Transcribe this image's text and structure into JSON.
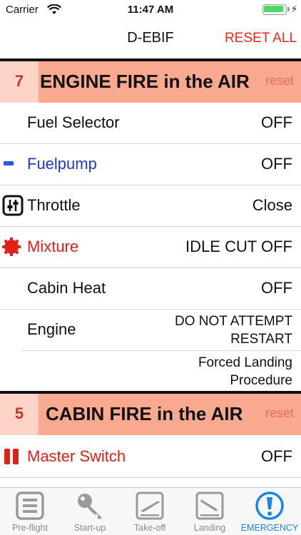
{
  "status": {
    "carrier": "Carrier",
    "time": "11:47 AM"
  },
  "nav": {
    "title": "D-EBIF",
    "reset_all": "RESET ALL"
  },
  "sections": [
    {
      "number": "7",
      "title": "ENGINE FIRE in the AIR",
      "reset": "reset",
      "items": [
        {
          "label": "Fuel Selector",
          "value": "OFF"
        },
        {
          "label": "Fuelpump",
          "value": "OFF",
          "icon": "blue-dash-icon"
        },
        {
          "label": "Throttle",
          "value": "Close",
          "icon": "throttle-icon"
        },
        {
          "label": "Mixture",
          "value": "IDLE CUT OFF",
          "icon": "red-gear-icon"
        },
        {
          "label": "Cabin Heat",
          "value": "OFF"
        },
        {
          "label": "Engine",
          "value_line1": "DO NOT ATTEMPT",
          "value_line2": "RESTART"
        },
        {
          "label": "",
          "value_line1": "Forced Landing",
          "value_line2": "Procedure"
        }
      ]
    },
    {
      "number": "5",
      "title": "CABIN FIRE in the AIR",
      "reset": "reset",
      "items": [
        {
          "label": "Master Switch",
          "value": "OFF",
          "icon": "red-switch-icon"
        }
      ]
    }
  ],
  "colors": {
    "accent_red": "#e8271c",
    "header_band": "#f8a98f",
    "number_box": "#fdd4c6",
    "tab_active": "#1a86e8",
    "blue_label": "#1d3ac8"
  },
  "tabs": [
    {
      "label": "Pre-flight",
      "icon": "checklist-icon"
    },
    {
      "label": "Start-up",
      "icon": "key-icon"
    },
    {
      "label": "Take-off",
      "icon": "takeoff-icon"
    },
    {
      "label": "Landing",
      "icon": "landing-icon"
    },
    {
      "label": "EMERGENCY",
      "icon": "exclamation-icon",
      "active": true
    }
  ]
}
